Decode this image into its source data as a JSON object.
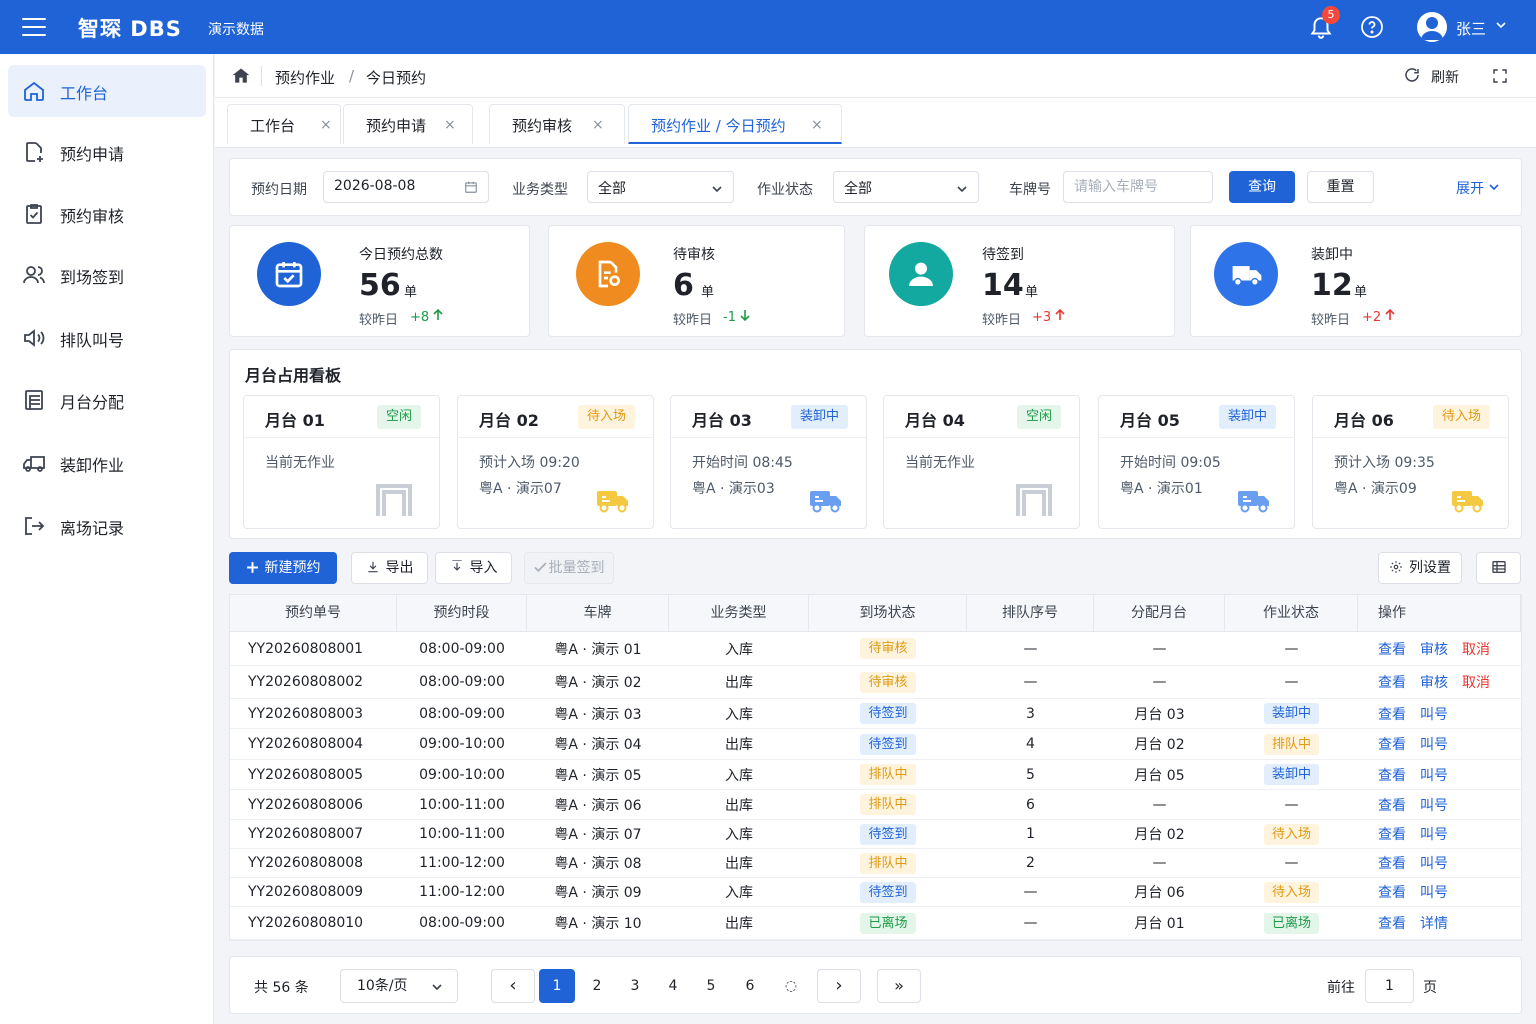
{
  "topbar": {
    "brand": "智琛 DBS",
    "demo": "演示数据",
    "badge": "5",
    "user": "张三",
    "menu_icon": "hamburger-icon",
    "bell_icon": "bell-icon",
    "help_icon": "question-icon"
  },
  "sidebar": {
    "items": [
      {
        "label": "工作台",
        "icon": "home-icon",
        "active": true
      },
      {
        "label": "预约申请",
        "icon": "document-add-icon"
      },
      {
        "label": "预约审核",
        "icon": "clipboard-check-icon"
      },
      {
        "label": "到场签到",
        "icon": "users-icon"
      },
      {
        "label": "排队叫号",
        "icon": "speaker-icon"
      },
      {
        "label": "月台分配",
        "icon": "dock-icon"
      },
      {
        "label": "装卸作业",
        "icon": "truck-icon"
      },
      {
        "label": "离场记录",
        "icon": "exit-icon"
      }
    ]
  },
  "breadcrumb": {
    "c1": "预约作业",
    "sep": "/",
    "c2": "今日预约",
    "refresh": "刷新"
  },
  "tabs": [
    {
      "label": "工作台"
    },
    {
      "label": "预约申请"
    },
    {
      "label": "预约审核"
    },
    {
      "label": "预约作业 / 今日预约",
      "active": true
    }
  ],
  "tab_close": "×",
  "filter": {
    "date_label": "预约日期",
    "date_value": "2026-08-08",
    "type_label": "业务类型",
    "type_value": "全部",
    "status_label": "作业状态",
    "status_value": "全部",
    "plate_label": "车牌号",
    "plate_placeholder": "请输入车牌号",
    "query": "查询",
    "reset": "重置",
    "expand": "展开"
  },
  "stats": [
    {
      "title": "今日预约总数",
      "value": "56",
      "unit": "单",
      "cmp": "较昨日",
      "delta": "+8",
      "dir": "up",
      "delta_color": "#1c9b4a",
      "icon": "calendar-check-icon",
      "color": "#1f63d6"
    },
    {
      "title": "待审核",
      "value": "6",
      "unit": "单",
      "cmp": "较昨日",
      "delta": "-1",
      "dir": "down",
      "delta_color": "#1c9b4a",
      "icon": "document-edit-icon",
      "color": "#f08c1f"
    },
    {
      "title": "待签到",
      "value": "14",
      "unit": "单",
      "cmp": "较昨日",
      "delta": "+3",
      "dir": "up",
      "delta_color": "#e8372f",
      "icon": "user-icon",
      "color": "#13a8a0"
    },
    {
      "title": "装卸中",
      "value": "12",
      "unit": "单",
      "cmp": "较昨日",
      "delta": "+2",
      "dir": "up",
      "delta_color": "#e8372f",
      "icon": "truck-icon",
      "color": "#2f73e8"
    }
  ],
  "board": {
    "title": "月台占用看板",
    "docks": [
      {
        "name": "月台 01",
        "status": "空闲",
        "kind": "idle",
        "l1": "当前无作业",
        "l2": "",
        "icon": "gate-icon"
      },
      {
        "name": "月台 02",
        "status": "待入场",
        "kind": "wait",
        "l1": "预计入场 09:20",
        "l2": "粤A · 演示07",
        "icon": "truck-icon"
      },
      {
        "name": "月台 03",
        "status": "装卸中",
        "kind": "load",
        "l1": "开始时间 08:45",
        "l2": "粤A · 演示03",
        "icon": "truck-icon"
      },
      {
        "name": "月台 04",
        "status": "空闲",
        "kind": "idle",
        "l1": "当前无作业",
        "l2": "",
        "icon": "gate-icon"
      },
      {
        "name": "月台 05",
        "status": "装卸中",
        "kind": "load",
        "l1": "开始时间 09:05",
        "l2": "粤A · 演示01",
        "icon": "truck-icon"
      },
      {
        "name": "月台 06",
        "status": "待入场",
        "kind": "wait",
        "l1": "预计入场 09:35",
        "l2": "粤A · 演示09",
        "icon": "truck-icon"
      }
    ]
  },
  "actions": {
    "new": "新建预约",
    "export": "导出",
    "import": "导入",
    "batch": "批量签到",
    "columns": "列设置"
  },
  "table": {
    "headers": [
      "预约单号",
      "预约时段",
      "车牌",
      "业务类型",
      "到场状态",
      "排队序号",
      "分配月台",
      "作业状态",
      "操作"
    ],
    "rows": [
      {
        "id": "YY20260808001",
        "slot": "08:00-09:00",
        "plate": "粤A · 演示 01",
        "type": "入库",
        "arrive": "待审核",
        "ak": "audit",
        "queue": "—",
        "dock": "—",
        "work": "—",
        "wk": "",
        "ops": [
          {
            "t": "查看"
          },
          {
            "t": "审核"
          },
          {
            "t": "取消",
            "red": true
          }
        ]
      },
      {
        "id": "YY20260808002",
        "slot": "08:00-09:00",
        "plate": "粤A · 演示 02",
        "type": "出库",
        "arrive": "待审核",
        "ak": "audit",
        "queue": "—",
        "dock": "—",
        "work": "—",
        "wk": "",
        "ops": [
          {
            "t": "查看"
          },
          {
            "t": "审核"
          },
          {
            "t": "取消",
            "red": true
          }
        ]
      },
      {
        "id": "YY20260808003",
        "slot": "08:00-09:00",
        "plate": "粤A · 演示 03",
        "type": "入库",
        "arrive": "待签到",
        "ak": "load",
        "queue": "3",
        "dock": "月台 03",
        "work": "装卸中",
        "wk": "load",
        "ops": [
          {
            "t": "查看"
          },
          {
            "t": "叫号"
          }
        ]
      },
      {
        "id": "YY20260808004",
        "slot": "09:00-10:00",
        "plate": "粤A · 演示 04",
        "type": "出库",
        "arrive": "待签到",
        "ak": "load",
        "queue": "4",
        "dock": "月台 02",
        "work": "排队中",
        "wk": "wait",
        "ops": [
          {
            "t": "查看"
          },
          {
            "t": "叫号"
          }
        ]
      },
      {
        "id": "YY20260808005",
        "slot": "09:00-10:00",
        "plate": "粤A · 演示 05",
        "type": "入库",
        "arrive": "排队中",
        "ak": "wait",
        "queue": "5",
        "dock": "月台 05",
        "work": "装卸中",
        "wk": "load",
        "ops": [
          {
            "t": "查看"
          },
          {
            "t": "叫号"
          }
        ]
      },
      {
        "id": "YY20260808006",
        "slot": "10:00-11:00",
        "plate": "粤A · 演示 06",
        "type": "出库",
        "arrive": "排队中",
        "ak": "wait",
        "queue": "6",
        "dock": "—",
        "work": "—",
        "wk": "",
        "ops": [
          {
            "t": "查看"
          },
          {
            "t": "叫号"
          }
        ]
      },
      {
        "id": "YY20260808007",
        "slot": "10:00-11:00",
        "plate": "粤A · 演示 07",
        "type": "入库",
        "arrive": "待签到",
        "ak": "load",
        "queue": "1",
        "dock": "月台 02",
        "work": "待入场",
        "wk": "wait",
        "ops": [
          {
            "t": "查看"
          },
          {
            "t": "叫号"
          }
        ]
      },
      {
        "id": "YY20260808008",
        "slot": "11:00-12:00",
        "plate": "粤A · 演示 08",
        "type": "出库",
        "arrive": "排队中",
        "ak": "wait",
        "queue": "2",
        "dock": "—",
        "work": "—",
        "wk": "",
        "ops": [
          {
            "t": "查看"
          },
          {
            "t": "叫号"
          }
        ]
      },
      {
        "id": "YY20260808009",
        "slot": "11:00-12:00",
        "plate": "粤A · 演示 09",
        "type": "入库",
        "arrive": "待签到",
        "ak": "load",
        "queue": "—",
        "dock": "月台 06",
        "work": "待入场",
        "wk": "wait",
        "ops": [
          {
            "t": "查看"
          },
          {
            "t": "叫号"
          }
        ]
      },
      {
        "id": "YY20260808010",
        "slot": "08:00-09:00",
        "plate": "粤A · 演示 10",
        "type": "出库",
        "arrive": "已离场",
        "ak": "left",
        "queue": "—",
        "dock": "月台 01",
        "work": "已离场",
        "wk": "left",
        "ops": [
          {
            "t": "查看"
          },
          {
            "t": "详情"
          }
        ]
      }
    ]
  },
  "pager": {
    "total": "共 56 条",
    "size": "10条/页",
    "pages": [
      "1",
      "2",
      "3",
      "4",
      "5",
      "6"
    ],
    "ellipsis": "◌",
    "prev": "‹",
    "next": "›",
    "last": "»",
    "goto": "前往",
    "goto_value": "1",
    "page_suffix": "页"
  }
}
